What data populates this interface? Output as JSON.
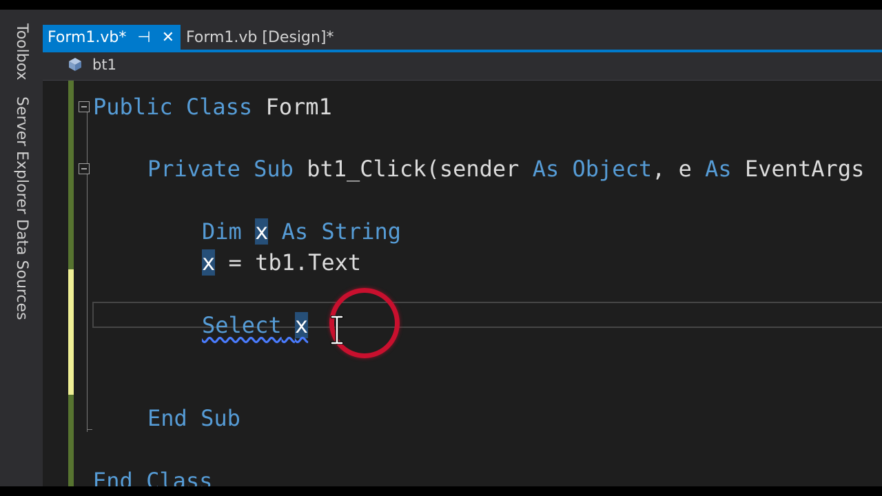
{
  "side_tabs": [
    "Toolbox",
    "Server Explorer",
    "Data Sources"
  ],
  "tabs": {
    "active": {
      "label": "Form1.vb*",
      "pin_glyph": "⊣",
      "close_glyph": "✕"
    },
    "inactive": {
      "label": "Form1.vb [Design]*"
    }
  },
  "nav": {
    "member": "bt1"
  },
  "code": {
    "line1": {
      "kw1": "Public",
      "kw2": "Class",
      "name": "Form1"
    },
    "line2": {
      "kw1": "Private",
      "kw2": "Sub",
      "name": "bt1_Click(sender",
      "as1": "As",
      "type1": "Object",
      "sep": ", e",
      "as2": "As",
      "type2": "EventArgs"
    },
    "line3": {
      "kw1": "Dim",
      "var": "x",
      "kw2": "As",
      "kw3": "String"
    },
    "line4": {
      "var": "x",
      "rest": "= tb1.Text"
    },
    "line5": {
      "kw": "Select",
      "var": "x"
    },
    "line6": {
      "kw1": "End",
      "kw2": "Sub"
    },
    "line7": {
      "kw1": "End",
      "kw2": "Class"
    }
  },
  "colors": {
    "accent": "#007acc",
    "keyword": "#569cd6",
    "highlight": "#264f78",
    "annotation_circle": "#c8102e"
  },
  "icons": {
    "nav_member": "cube-icon",
    "cursor": "ibeam-cursor-icon"
  }
}
